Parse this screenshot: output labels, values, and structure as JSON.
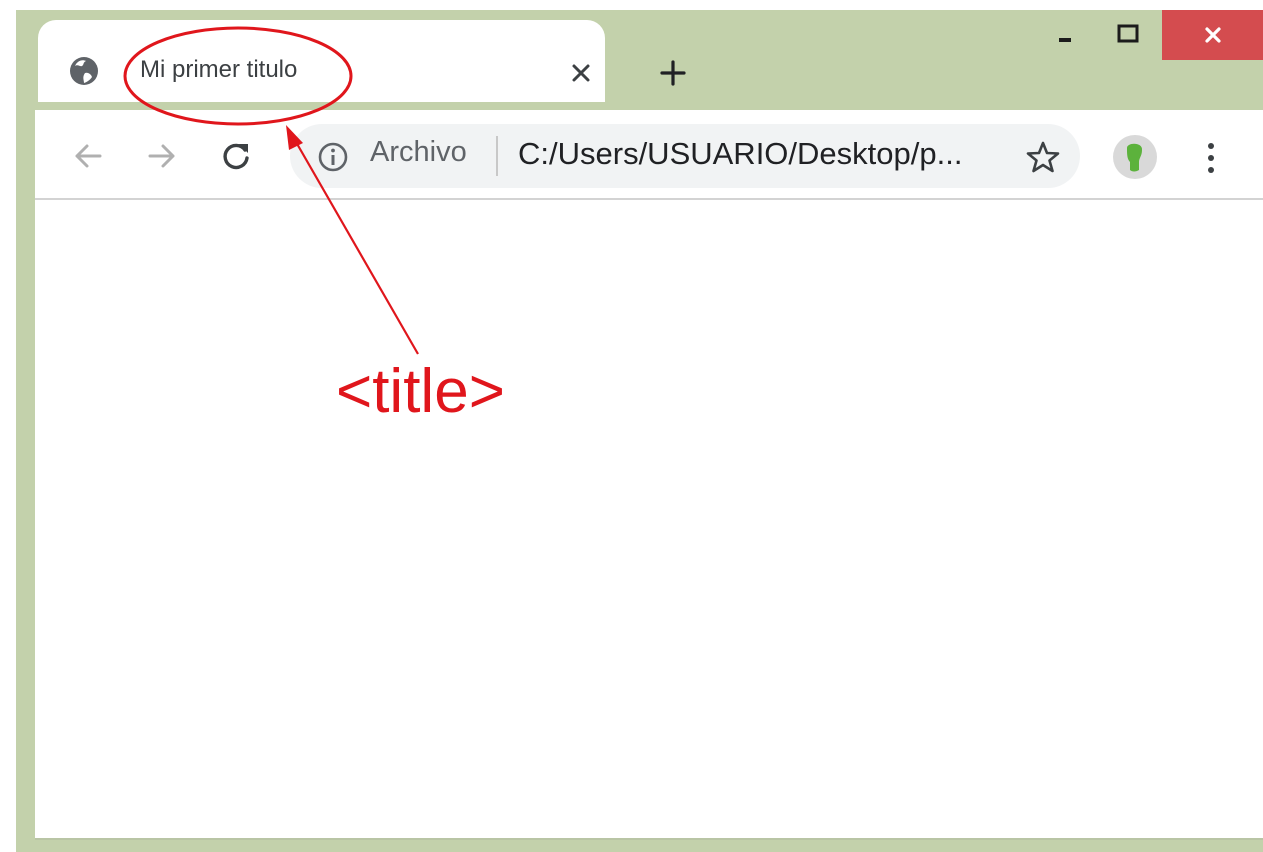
{
  "tab": {
    "title": "Mi primer titulo",
    "favicon": "globe-icon"
  },
  "toolbar": {
    "security_label": "Archivo",
    "url": "C:/Users/USUARIO/Desktop/p..."
  },
  "icons": {
    "back": "arrow-left-icon",
    "forward": "arrow-right-icon",
    "reload": "reload-icon",
    "info": "info-icon",
    "bookmark": "star-icon",
    "profile": "profile-avatar",
    "menu": "kebab-menu-icon",
    "new_tab": "plus-icon",
    "close_tab": "close-icon",
    "window_min": "minimize-icon",
    "window_max": "maximize-icon",
    "window_close": "close-icon"
  },
  "annotation": {
    "label": "<title>",
    "color": "#e0161c"
  },
  "colors": {
    "frame": "#c3d1ab",
    "close_button": "#d44c4f",
    "omnibox": "#f1f3f4"
  }
}
